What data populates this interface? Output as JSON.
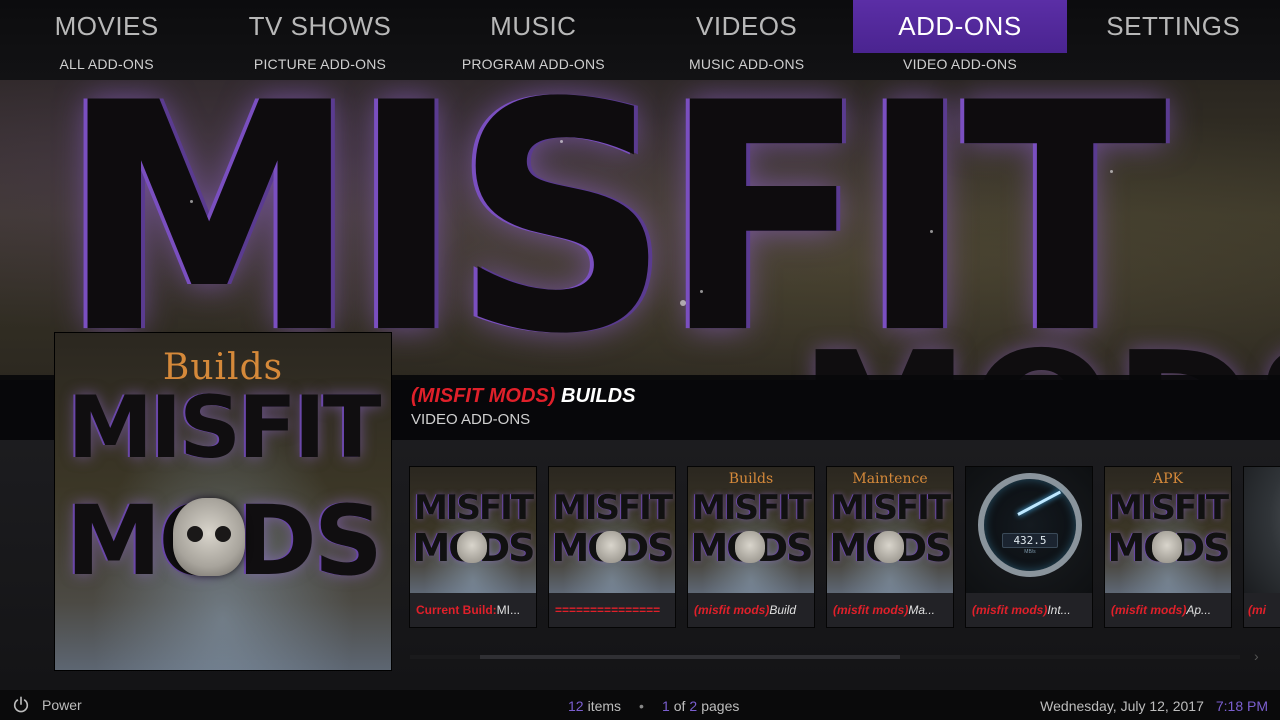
{
  "main_menu": [
    "MOVIES",
    "TV SHOWS",
    "MUSIC",
    "VIDEOS",
    "ADD-ONS",
    "SETTINGS"
  ],
  "sub_menu": [
    "ALL ADD-ONS",
    "PICTURE ADD-ONS",
    "PROGRAM ADD-ONS",
    "MUSIC ADD-ONS",
    "VIDEO ADD-ONS"
  ],
  "fanart": {
    "word": "MISFIT",
    "word2": "MODS"
  },
  "selected": {
    "title_red": "(MISFIT MODS)",
    "title_rest": " BUILDS",
    "subtitle": "VIDEO ADD-ONS"
  },
  "poster": {
    "builds": "Builds",
    "misfit": "MISFIT",
    "mods": "MODS"
  },
  "thumbs": [
    {
      "top": "",
      "red": "Current Build:",
      "rest": " MI..."
    },
    {
      "top": "",
      "red": "===============",
      "rest": ""
    },
    {
      "top": "Builds",
      "red": "(misfit mods)",
      "rest": " Build"
    },
    {
      "top": "Maintence",
      "red": "(misfit mods)",
      "rest": " Ma..."
    },
    {
      "top": "",
      "red": "(misfit mods)",
      "rest": " Int..."
    },
    {
      "top": "APK",
      "red": "(misfit mods)",
      "rest": " Ap..."
    },
    {
      "top": "",
      "red": "(mi",
      "rest": ""
    }
  ],
  "thumb_art": {
    "m1": "MISFIT",
    "m2": "MODS"
  },
  "gauge": {
    "readout": "432.5",
    "unit": "MB/s"
  },
  "footer": {
    "power": "Power",
    "items_count": "12",
    "items_label": "items",
    "page": "1",
    "of_label": "of",
    "pages": "2",
    "pages_label": "pages",
    "date": "Wednesday, July 12, 2017",
    "time": "7:18 PM"
  },
  "colors": {
    "accent": "#5b2ea6",
    "red": "#e0202a",
    "footer_accent": "#7b5fd0"
  }
}
